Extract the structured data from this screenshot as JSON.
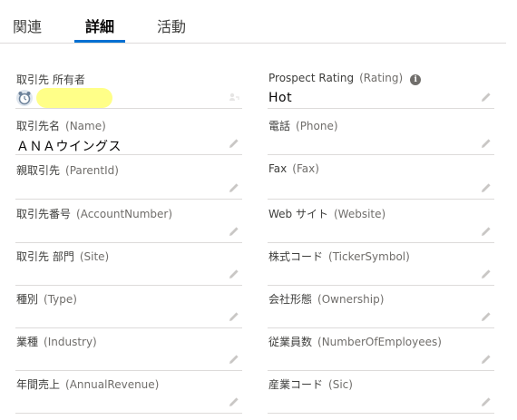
{
  "tabs": [
    {
      "label": "関連",
      "active": false
    },
    {
      "label": "詳細",
      "active": true
    },
    {
      "label": "活動",
      "active": false
    }
  ],
  "accent_color": "#0070d2",
  "owner_highlight_color": "#ffff88",
  "fields": {
    "owner": {
      "label": "取引先 所有者",
      "api": "",
      "value": ""
    },
    "rating": {
      "label": "Prospect Rating",
      "api": "(Rating)",
      "value": "Hot"
    },
    "name": {
      "label": "取引先名",
      "api": "(Name)",
      "value": "ＡＮＡウイングス"
    },
    "phone": {
      "label": "電話",
      "api": "(Phone)",
      "value": ""
    },
    "parent": {
      "label": "親取引先",
      "api": "(ParentId)",
      "value": ""
    },
    "fax": {
      "label": "Fax",
      "api": "(Fax)",
      "value": ""
    },
    "account_number": {
      "label": "取引先番号",
      "api": "(AccountNumber)",
      "value": ""
    },
    "website": {
      "label": "Web サイト",
      "api": "(Website)",
      "value": ""
    },
    "site": {
      "label": "取引先 部門",
      "api": "(Site)",
      "value": ""
    },
    "ticker": {
      "label": "株式コード",
      "api": "(TickerSymbol)",
      "value": ""
    },
    "type": {
      "label": "種別",
      "api": "(Type)",
      "value": ""
    },
    "ownership": {
      "label": "会社形態",
      "api": "(Ownership)",
      "value": ""
    },
    "industry": {
      "label": "業種",
      "api": "(Industry)",
      "value": ""
    },
    "employees": {
      "label": "従業員数",
      "api": "(NumberOfEmployees)",
      "value": ""
    },
    "revenue": {
      "label": "年間売上",
      "api": "(AnnualRevenue)",
      "value": ""
    },
    "sic": {
      "label": "産業コード",
      "api": "(Sic)",
      "value": ""
    }
  },
  "icons": {
    "edit": "pencil-icon",
    "info": "info-icon",
    "change_owner": "change-owner-icon",
    "avatar": "user-avatar-icon"
  }
}
